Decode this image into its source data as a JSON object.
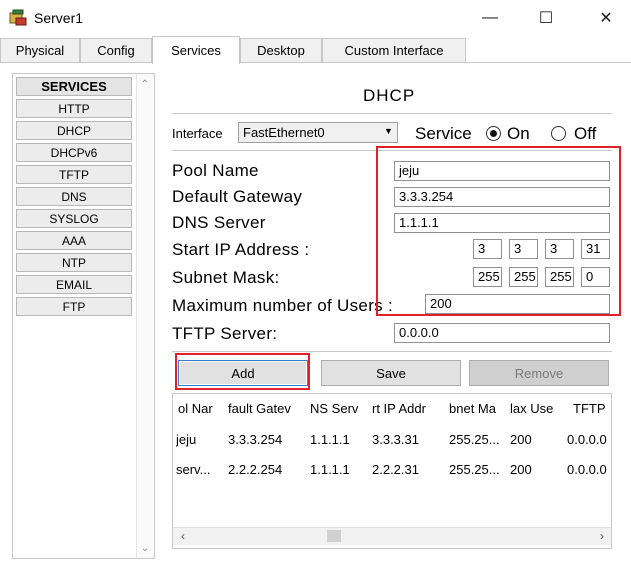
{
  "window": {
    "title": "Server1",
    "icon": "server-icon",
    "controls": {
      "minimize": "—",
      "maximize": "☐",
      "close": "✕"
    }
  },
  "tabs": [
    {
      "label": "Physical",
      "active": false
    },
    {
      "label": "Config",
      "active": false
    },
    {
      "label": "Services",
      "active": true
    },
    {
      "label": "Desktop",
      "active": false
    },
    {
      "label": "Custom Interface",
      "active": false
    }
  ],
  "sidebar": {
    "header": "SERVICES",
    "items": [
      "HTTP",
      "DHCP",
      "DHCPv6",
      "TFTP",
      "DNS",
      "SYSLOG",
      "AAA",
      "NTP",
      "EMAIL",
      "FTP"
    ]
  },
  "dhcp": {
    "title": "DHCP",
    "interface_label": "Interface",
    "interface_value": "FastEthernet0",
    "service_label": "Service",
    "on_label": "On",
    "off_label": "Off",
    "service_state": "On",
    "fields": {
      "pool_name": {
        "label": "Pool Name",
        "value": "jeju"
      },
      "default_gateway": {
        "label": "Default Gateway",
        "value": "3.3.3.254"
      },
      "dns_server": {
        "label": "DNS Server",
        "value": "1.1.1.1"
      },
      "start_ip": {
        "label": "Start IP Address :",
        "octets": [
          "3",
          "3",
          "3",
          "31"
        ]
      },
      "subnet_mask": {
        "label": "Subnet Mask:",
        "octets": [
          "255",
          "255",
          "255",
          "0"
        ]
      },
      "max_users": {
        "label": "Maximum number of Users :",
        "value": "200"
      },
      "tftp_server": {
        "label": "TFTP Server:",
        "value": "0.0.0.0"
      }
    },
    "buttons": {
      "add": "Add",
      "save": "Save",
      "remove": "Remove"
    },
    "table": {
      "headers": [
        "ol Nar",
        "fault Gatev",
        "NS Serv",
        "rt IP Addr",
        "bnet Ma",
        "lax Use",
        "TFTP"
      ],
      "rows": [
        [
          "jeju",
          "3.3.3.254",
          "1.1.1.1",
          "3.3.3.31",
          "255.25...",
          "200",
          "0.0.0.0"
        ],
        [
          "serv...",
          "2.2.2.254",
          "1.1.1.1",
          "2.2.2.31",
          "255.25...",
          "200",
          "0.0.0.0"
        ]
      ]
    }
  },
  "colors": {
    "highlight": "#e0202a",
    "tab_bg": "#f0f0f0",
    "button_bg": "#e1e1e1"
  }
}
